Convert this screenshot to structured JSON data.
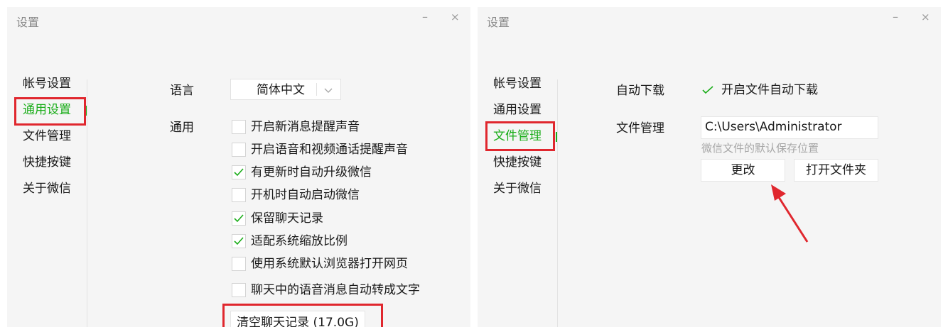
{
  "left_window": {
    "title": "设置",
    "minimize_glyph": "–",
    "close_glyph": "×",
    "nav": [
      "帐号设置",
      "通用设置",
      "文件管理",
      "快捷按键",
      "关于微信"
    ],
    "active_nav": "通用设置",
    "language_label": "语言",
    "language_value": "简体中文",
    "general_label": "通用",
    "options": [
      {
        "label": "开启新消息提醒声音",
        "checked": false
      },
      {
        "label": "开启语音和视频通话提醒声音",
        "checked": false
      },
      {
        "label": "有更新时自动升级微信",
        "checked": true
      },
      {
        "label": "开机时自动启动微信",
        "checked": false
      },
      {
        "label": "保留聊天记录",
        "checked": true
      },
      {
        "label": "适配系统缩放比例",
        "checked": true
      },
      {
        "label": "使用系统默认浏览器打开网页",
        "checked": false
      },
      {
        "label": "聊天中的语音消息自动转成文字",
        "checked": false
      }
    ],
    "clear_history_button": "清空聊天记录 (17.0G)"
  },
  "right_window": {
    "title": "设置",
    "minimize_glyph": "–",
    "close_glyph": "×",
    "nav": [
      "帐号设置",
      "通用设置",
      "文件管理",
      "快捷按键",
      "关于微信"
    ],
    "active_nav": "文件管理",
    "auto_download_label": "自动下载",
    "auto_download_option": "开启文件自动下载",
    "auto_download_checked": true,
    "file_manage_label": "文件管理",
    "file_path": "C:\\Users\\Administrator",
    "file_path_hint": "微信文件的默认保存位置",
    "change_button": "更改",
    "open_folder_button": "打开文件夹"
  },
  "colors": {
    "accent_green": "#1aad19",
    "highlight_red": "#e0272e"
  },
  "icons": {
    "check": "check-icon",
    "chevron": "chevron-down-icon",
    "arrow": "red-arrow-annotation"
  }
}
